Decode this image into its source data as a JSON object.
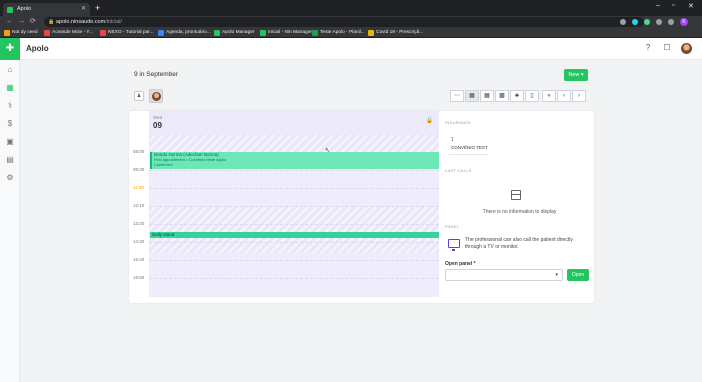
{
  "browser": {
    "tab_title": "Apolo",
    "url_host": "apolo.ninsaude.com",
    "url_path": "/inicial/",
    "profile_initial": "K",
    "bookmarks": [
      {
        "label": "Not dy ceed",
        "color": "#f59e0b"
      },
      {
        "label": "Aceasde Mcle - Y...",
        "color": "#ef4444"
      },
      {
        "label": "NEXO - Tutorial par...",
        "color": "#ef4444"
      },
      {
        "label": "Agenda, prontuário...",
        "color": "#3b82f6"
      },
      {
        "label": "Apolo Manager",
        "color": "#22c55e"
      },
      {
        "label": "Inicial - Nin Manager",
        "color": "#22c55e"
      },
      {
        "label": "Teste Apolo - Planil...",
        "color": "#16a34a"
      },
      {
        "label": "Covid 19 - Prescriçã...",
        "color": "#eab308"
      }
    ]
  },
  "app": {
    "title": "Apolo"
  },
  "page": {
    "heading": "9 in September",
    "new_button": "New ▾"
  },
  "day": {
    "weekday": "Wed",
    "number": "09"
  },
  "times": [
    "08:00",
    "09:30",
    "11:00",
    "12:10",
    "13:20",
    "14:30",
    "15:40",
    "16:50"
  ],
  "events": [
    {
      "line1": "Dendo Norma (Adecfam Norma)",
      "line2": "First appointment • Convênio teste Apolo",
      "line3": "Confirmed"
    },
    {
      "line1": "Daily stand"
    }
  ],
  "panel": {
    "insurance_label": "INSURANCE",
    "insurance_number": "1",
    "insurance_name": "CONVÊNIO TEST",
    "last_calls_label": "LAST CALLS",
    "no_info": "There is no information to display",
    "panel_label": "PANEL",
    "panel_desc": "The professional can also call the patient directly through a TV or monitor.",
    "open_panel_label": "Open panel *",
    "open_button": "Open"
  }
}
